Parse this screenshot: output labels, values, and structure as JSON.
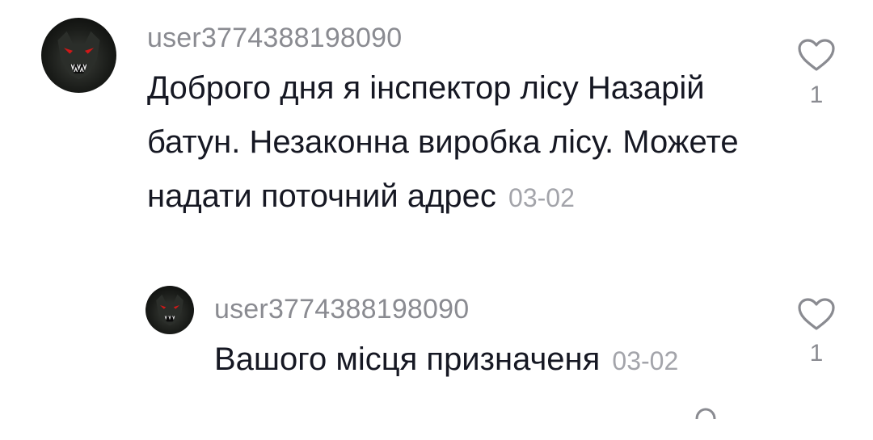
{
  "comments": [
    {
      "username": "user3774388198090",
      "text": "Доброго дня я інспектор лісу Назарій батун. Незаконна виробка лісу. Можете надати поточний адрес",
      "date": "03-02",
      "likes": "1",
      "avatar_icon": "wolf-avatar-icon",
      "like_icon": "heart-outline-icon"
    }
  ],
  "replies": [
    {
      "username": "user3774388198090",
      "text": "Вашого місця призначеня",
      "date": "03-02",
      "likes": "1",
      "avatar_icon": "wolf-avatar-icon",
      "like_icon": "heart-outline-icon"
    }
  ],
  "colors": {
    "username": "#8a8b91",
    "text": "#161823",
    "date": "#a3a4aa",
    "heart": "#8a8b91"
  }
}
